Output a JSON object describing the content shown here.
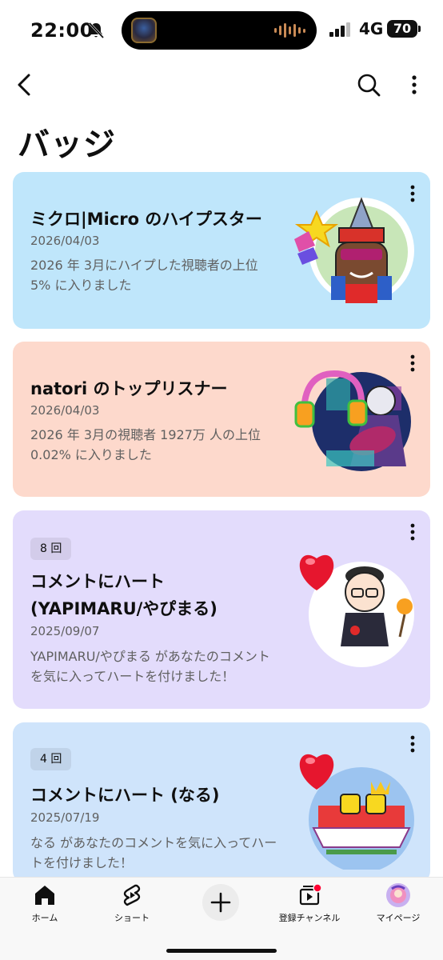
{
  "status": {
    "time": "22:00",
    "network": "4G",
    "battery": "70"
  },
  "page": {
    "title": "バッジ"
  },
  "cards": [
    {
      "title": "ミクロ|Micro のハイプスター",
      "date": "2026/04/03",
      "description": "2026 年 3月にハイプした視聴者の上位 5% に入りました",
      "color": "#bfe6fb"
    },
    {
      "title": "natori のトップリスナー",
      "date": "2026/04/03",
      "description": "2026 年 3月の視聴者 1927万 人の上位 0.02% に入りました",
      "color": "#fdd9cc"
    },
    {
      "count": "8 回",
      "title_line1": "コメントにハート",
      "title_line2": "(YAPIMARU/やぴまる)",
      "date": "2025/09/07",
      "description": "YAPIMARU/やぴまる があなたのコメントを気に入ってハートを付けました！",
      "color": "#e3dcfc"
    },
    {
      "count": "4 回",
      "title": "コメントにハート (なる)",
      "date": "2025/07/19",
      "description": "なる があなたのコメントを気に入ってハートを付けました！",
      "color": "#cfe4fb"
    }
  ],
  "bottom_nav": {
    "home": "ホーム",
    "shorts": "ショート",
    "subscriptions": "登録チャンネル",
    "mypage": "マイページ"
  },
  "icons": {
    "accent_red": "#ff0033"
  }
}
